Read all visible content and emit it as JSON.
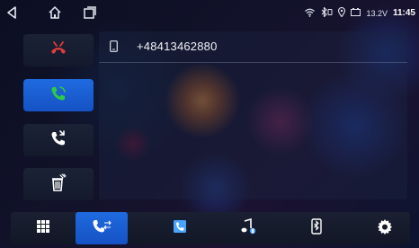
{
  "status_bar": {
    "icons": [
      "back-icon",
      "home-icon",
      "recent-apps-icon",
      "wifi-icon",
      "bluetooth-icon",
      "location-icon",
      "battery-icon"
    ],
    "voltage": "13.2V",
    "time": "11:45"
  },
  "call_buttons": [
    {
      "name": "hang-up-button",
      "icon": "phone-hangup-icon",
      "color": "#e23b3b",
      "active": false
    },
    {
      "name": "answer-button",
      "icon": "phone-answer-icon",
      "color": "#2ecc40",
      "active": true
    },
    {
      "name": "switch-call-button",
      "icon": "phone-switch-icon",
      "color": "#ffffff",
      "active": false
    },
    {
      "name": "delete-button",
      "icon": "trash-icon",
      "color": "#ffffff",
      "active": false
    }
  ],
  "dial": {
    "number": "+48413462880",
    "icon": "mobile-phone-icon"
  },
  "bottom_nav": [
    {
      "name": "keypad",
      "icon": "keypad-grid-icon",
      "active": false
    },
    {
      "name": "call-log",
      "icon": "call-log-icon",
      "active": true
    },
    {
      "name": "contacts",
      "icon": "contacts-icon",
      "active": false
    },
    {
      "name": "bt-music",
      "icon": "bluetooth-music-icon",
      "active": false
    },
    {
      "name": "bt-devices",
      "icon": "bluetooth-phone-icon",
      "active": false
    },
    {
      "name": "settings",
      "icon": "settings-gear-icon",
      "active": false
    }
  ],
  "colors": {
    "accent": "#1f6ae0",
    "hangup": "#e23b3b",
    "answer": "#2ecc40",
    "time": "#ffffff"
  }
}
